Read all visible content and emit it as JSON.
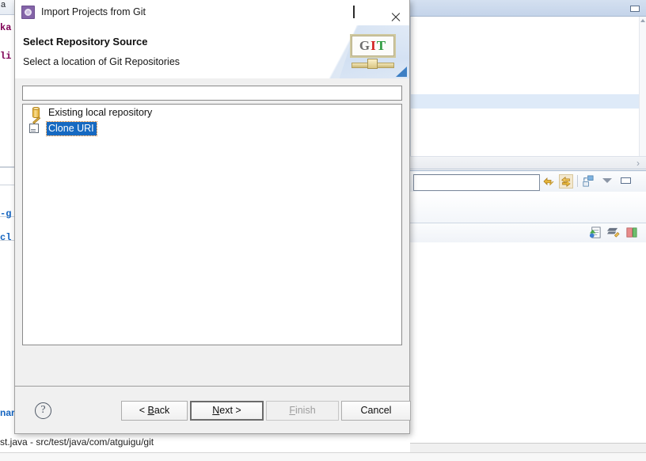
{
  "dialog": {
    "title": "Import Projects from Git",
    "icon": "eclipse-wizard-icon",
    "banner": {
      "heading": "Select Repository Source",
      "subheading": "Select a location of Git Repositories",
      "logo_letters": {
        "g": "G",
        "i": "I",
        "t": "T"
      },
      "logo_name": "git-logo"
    },
    "window_controls": {
      "minimize": "minimize-icon",
      "maximize": "maximize-icon",
      "close": "close-icon"
    },
    "filter": {
      "value": "",
      "placeholder": ""
    },
    "list": {
      "items": [
        {
          "label": "Existing local repository",
          "icon": "repository-cylinder-icon",
          "selected": false
        },
        {
          "label": "Clone URI",
          "icon": "clone-uri-page-pencil-icon",
          "selected": true
        }
      ]
    },
    "footer": {
      "help_glyph": "?",
      "buttons": [
        {
          "name": "back-button",
          "label_pre": "< ",
          "mnemonic": "B",
          "label_post": "ack",
          "state": "enabled"
        },
        {
          "name": "next-button",
          "label_pre": "",
          "mnemonic": "N",
          "label_post": "ext >",
          "state": "default"
        },
        {
          "name": "finish-button",
          "label_pre": "",
          "mnemonic": "F",
          "label_post": "inish",
          "state": "disabled"
        },
        {
          "name": "cancel-button",
          "label_pre": "",
          "mnemonic": "",
          "label_post": "Cancel",
          "state": "enabled"
        }
      ]
    },
    "colors": {
      "selection_blue": "#1669c1",
      "focus_outline": "#c06a16",
      "dialog_bg": "#f0f0f0",
      "title_icon_purple": "#8464a8"
    }
  },
  "background": {
    "editor_tab_fragment": "a",
    "code_fragments": [
      "ka",
      "li"
    ],
    "outline_fragments": [
      "-g",
      "cl"
    ],
    "bottom_link_fragment": "nar",
    "status_text": "st.java - src/test/java/com/atguigu/git"
  }
}
